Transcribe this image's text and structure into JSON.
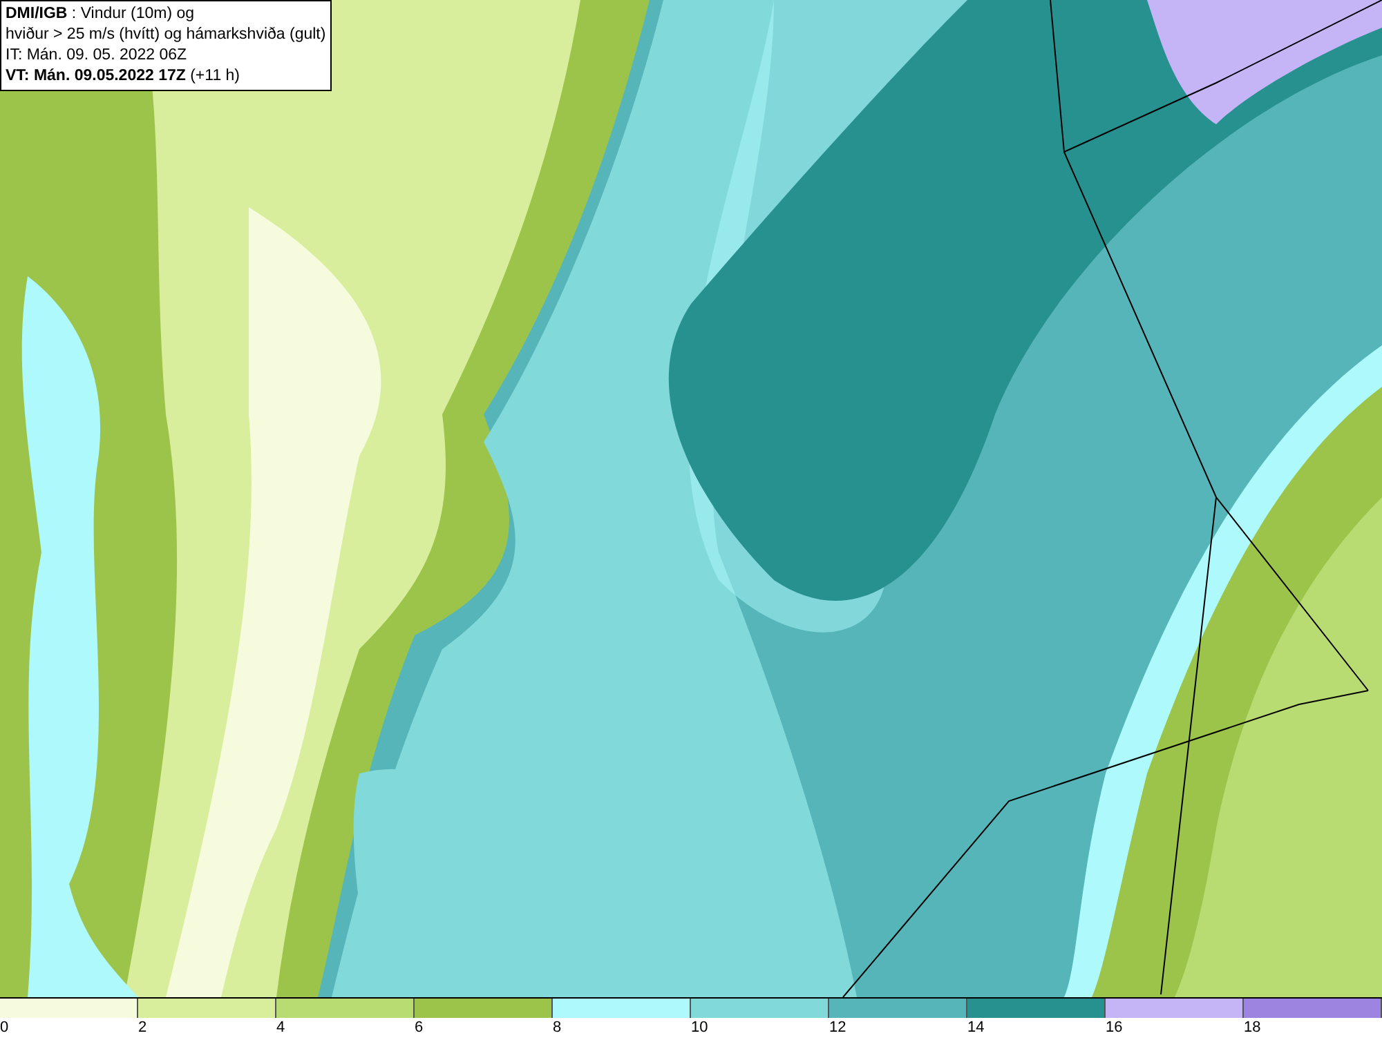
{
  "title_box": {
    "lines": [
      "**DMI/IGB** : Vindur (10m) og",
      "hviður > 25 m/s (hvítt) og hámarkshviða (gult)",
      "IT: Mán. 09. 05. 2022 06Z",
      "**VT: Mán. 09.05.2022 17Z** (+11 h)"
    ]
  },
  "legend": {
    "bins": [
      {
        "tick": "0",
        "color": "#f5fbdc"
      },
      {
        "tick": "2",
        "color": "#d8ee9c"
      },
      {
        "tick": "4",
        "color": "#b9dc72"
      },
      {
        "tick": "6",
        "color": "#9cc44a"
      },
      {
        "tick": "8",
        "color": "#aef9fb"
      },
      {
        "tick": "10",
        "color": "#82d9da"
      },
      {
        "tick": "12",
        "color": "#55b5b8"
      },
      {
        "tick": "14",
        "color": "#27918f"
      },
      {
        "tick": "16",
        "color": "#c5b5f7"
      },
      {
        "tick": "18",
        "color": "#9d84e0"
      }
    ]
  }
}
